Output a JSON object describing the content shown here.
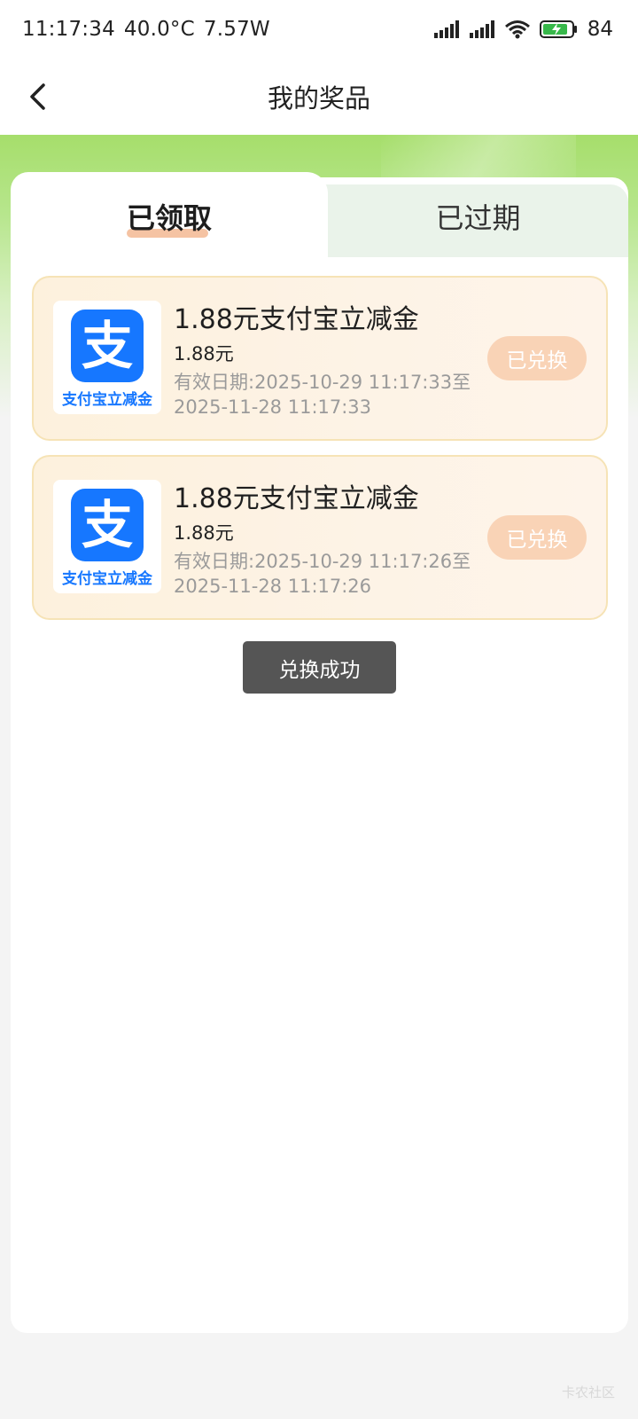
{
  "status_bar": {
    "time": "11:17:34",
    "temperature": "40.0°C",
    "power": "7.57W",
    "battery": "84"
  },
  "nav": {
    "title": "我的奖品"
  },
  "tabs": [
    {
      "label": "已领取",
      "active": true
    },
    {
      "label": "已过期",
      "active": false
    }
  ],
  "prizes": [
    {
      "logo_caption": "支付宝立减金",
      "logo_glyph": "支",
      "title": "1.88元支付宝立减金",
      "amount": "1.88元",
      "validity": "有效日期:2025-10-29 11:17:33至2025-11-28 11:17:33",
      "status_label": "已兑换"
    },
    {
      "logo_caption": "支付宝立减金",
      "logo_glyph": "支",
      "title": "1.88元支付宝立减金",
      "amount": "1.88元",
      "validity": "有效日期:2025-10-29 11:17:26至2025-11-28 11:17:26",
      "status_label": "已兑换"
    }
  ],
  "toast": "兑换成功",
  "watermark": "卡农社区",
  "colors": {
    "accent_green": "#a6de6b",
    "alipay_blue": "#1677ff",
    "redeemed_button": "#f9d3b6",
    "tab_underline": "#f5c3a3"
  }
}
